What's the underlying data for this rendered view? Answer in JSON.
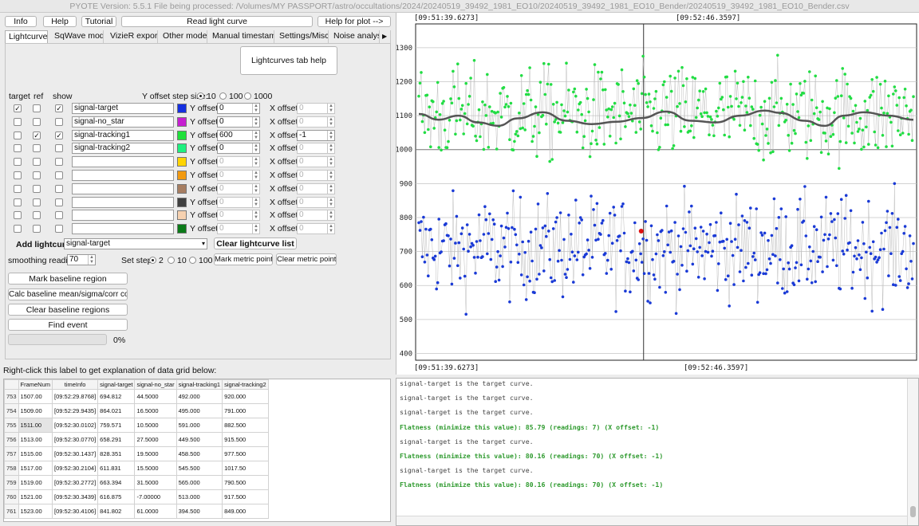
{
  "window_title": "PYOTE Version: 5.5.1  File being processed: /Volumes/MY PASSPORT/astro/occultations/2024/20240519_39492_1981_EO10/20240519_39492_1981_EO10_Bender/20240519_39492_1981_EO10_Bender.csv",
  "toolbar": {
    "info": "Info",
    "help": "Help",
    "tutorial": "Tutorial",
    "read_lc": "Read light curve",
    "help_plot": "Help for plot -->"
  },
  "tabs": [
    "Lightcurves",
    "SqWave model",
    "VizieR export",
    "Other models",
    "Manual timestamps",
    "Settings/Misc.",
    "Noise analysis/"
  ],
  "tab_help": "Lightcurves tab help",
  "headers": {
    "target": "target",
    "ref": "ref",
    "show": "show"
  },
  "y_step": {
    "label": "Y offset step size:",
    "options": [
      "10",
      "100",
      "1000"
    ],
    "selected": "10"
  },
  "y_offset_label": "Y offset:",
  "x_offset_label": "X offset:",
  "rows": [
    {
      "name": "signal-target",
      "color": "#1530e0",
      "target": true,
      "ref": false,
      "show": true,
      "yoff": "0",
      "xoff": "0",
      "enabled": true,
      "xenabled": false
    },
    {
      "name": "signal-no_star",
      "color": "#c61fd1",
      "target": false,
      "ref": false,
      "show": false,
      "yoff": "0",
      "xoff": "0",
      "enabled": true,
      "xenabled": false
    },
    {
      "name": "signal-tracking1",
      "color": "#1fe03a",
      "target": false,
      "ref": true,
      "show": true,
      "yoff": "600",
      "xoff": "-1",
      "enabled": true,
      "xenabled": true
    },
    {
      "name": "signal-tracking2",
      "color": "#1ef07f",
      "target": false,
      "ref": false,
      "show": false,
      "yoff": "0",
      "xoff": "0",
      "enabled": true,
      "xenabled": false
    },
    {
      "name": "",
      "color": "#ffd400",
      "target": false,
      "ref": false,
      "show": false,
      "yoff": "0",
      "xoff": "0",
      "enabled": false,
      "xenabled": false
    },
    {
      "name": "",
      "color": "#f29a10",
      "target": false,
      "ref": false,
      "show": false,
      "yoff": "0",
      "xoff": "0",
      "enabled": false,
      "xenabled": false
    },
    {
      "name": "",
      "color": "#a77e62",
      "target": false,
      "ref": false,
      "show": false,
      "yoff": "0",
      "xoff": "0",
      "enabled": false,
      "xenabled": false
    },
    {
      "name": "",
      "color": "#404040",
      "target": false,
      "ref": false,
      "show": false,
      "yoff": "0",
      "xoff": "0",
      "enabled": false,
      "xenabled": false
    },
    {
      "name": "",
      "color": "#f6d1b0",
      "target": false,
      "ref": false,
      "show": false,
      "yoff": "0",
      "xoff": "0",
      "enabled": false,
      "xenabled": false
    },
    {
      "name": "",
      "color": "#0b7a18",
      "target": false,
      "ref": false,
      "show": false,
      "yoff": "0",
      "xoff": "0",
      "enabled": false,
      "xenabled": false
    }
  ],
  "add_lc": {
    "label": "Add lightcurve",
    "value": "signal-target",
    "clear": "Clear lightcurve list"
  },
  "smoothing": {
    "label": "smoothing readings",
    "value": "70"
  },
  "set_step": {
    "label": "Set step:",
    "options": [
      "2",
      "10",
      "100"
    ],
    "selected": "2"
  },
  "metric": {
    "mark": "Mark metric points",
    "clear": "Clear metric points"
  },
  "baseline": {
    "mark": "Mark baseline region",
    "calc": "Calc baseline mean/sigma/corr coeffs",
    "clear": "Clear baseline regions",
    "find": "Find event"
  },
  "progress": {
    "value": 0,
    "text": "0%"
  },
  "grid_label": "Right-click this label to get explanation of data grid below:",
  "grid": {
    "columns": [
      "FrameNum",
      "timeInfo",
      "signal-target",
      "signal-no_star",
      "signal-tracking1",
      "signal-tracking2"
    ],
    "rows": [
      [
        "753",
        "1507.00",
        "[09:52:29.8768]",
        "694.812",
        "44.5000",
        "492.000",
        "920.000"
      ],
      [
        "754",
        "1509.00",
        "[09:52:29.9435]",
        "864.021",
        "16.5000",
        "495.000",
        "791.000"
      ],
      [
        "755",
        "1511.00",
        "[09:52:30.0102]",
        "759.571",
        "10.5000",
        "591.000",
        "882.500"
      ],
      [
        "756",
        "1513.00",
        "[09:52:30.0770]",
        "658.291",
        "27.5000",
        "449.500",
        "915.500"
      ],
      [
        "757",
        "1515.00",
        "[09:52:30.1437]",
        "828.351",
        "19.5000",
        "458.500",
        "977.500"
      ],
      [
        "758",
        "1517.00",
        "[09:52:30.2104]",
        "611.831",
        "15.5000",
        "545.500",
        "1017.50"
      ],
      [
        "759",
        "1519.00",
        "[09:52:30.2772]",
        "663.394",
        "31.5000",
        "565.000",
        "790.500"
      ],
      [
        "760",
        "1521.00",
        "[09:52:30.3439]",
        "616.875",
        "-7.00000",
        "513.000",
        "917.500"
      ],
      [
        "761",
        "1523.00",
        "[09:52:30.4106]",
        "841.802",
        "61.0000",
        "394.500",
        "849.000"
      ]
    ]
  },
  "log": [
    {
      "text": "signal-target is the target curve.",
      "flat": false
    },
    {
      "text": "signal-target is the target curve.",
      "flat": false
    },
    {
      "text": "signal-target is the target curve.",
      "flat": false
    },
    {
      "text": "Flatness (minimize this value): 85.79 (readings: 7) (X offset: -1)",
      "flat": true
    },
    {
      "text": "signal-target is the target curve.",
      "flat": false
    },
    {
      "text": "Flatness (minimize this value): 80.16 (readings: 70) (X offset: -1)",
      "flat": true
    },
    {
      "text": "signal-target is the target curve.",
      "flat": false
    },
    {
      "text": "Flatness (minimize this value): 80.16 (readings: 70) (X offset: -1)",
      "flat": true
    }
  ],
  "chart_data": {
    "type": "scatter",
    "x_range": [
      "[09:51:39.6273]",
      "[09:52:46.3597]"
    ],
    "top_left_label": "[09:51:39.6273]",
    "top_right_label": "[09:52:46.3597]",
    "bottom_left_label": "[09:51:39.6273]",
    "bottom_right_label": "[09:52:46.3597]",
    "ylim": [
      380,
      1370
    ],
    "yticks": [
      400,
      500,
      600,
      700,
      800,
      900,
      1000,
      1100,
      1200,
      1300
    ],
    "series": [
      {
        "name": "signal-target",
        "color": "#1a3ad6",
        "mean": 710,
        "spread": 75
      },
      {
        "name": "signal-tracking1",
        "color": "#22dd44",
        "mean": 1105,
        "spread": 70
      }
    ],
    "smooth_series_color": "#555555",
    "smooth_points": [
      [
        0,
        1105
      ],
      [
        0.04,
        1088
      ],
      [
        0.08,
        1100
      ],
      [
        0.12,
        1080
      ],
      [
        0.16,
        1070
      ],
      [
        0.2,
        1092
      ],
      [
        0.25,
        1110
      ],
      [
        0.3,
        1085
      ],
      [
        0.35,
        1075
      ],
      [
        0.4,
        1082
      ],
      [
        0.45,
        1093
      ],
      [
        0.5,
        1112
      ],
      [
        0.55,
        1085
      ],
      [
        0.6,
        1080
      ],
      [
        0.65,
        1100
      ],
      [
        0.7,
        1115
      ],
      [
        0.73,
        1108
      ],
      [
        0.78,
        1085
      ],
      [
        0.82,
        1070
      ],
      [
        0.86,
        1100
      ],
      [
        0.9,
        1110
      ],
      [
        0.95,
        1100
      ],
      [
        1.0,
        1088
      ]
    ],
    "marker_value": 760,
    "marker_color": "#e01010",
    "cursor_x": "[09:52:30.0102]",
    "grid": true
  }
}
